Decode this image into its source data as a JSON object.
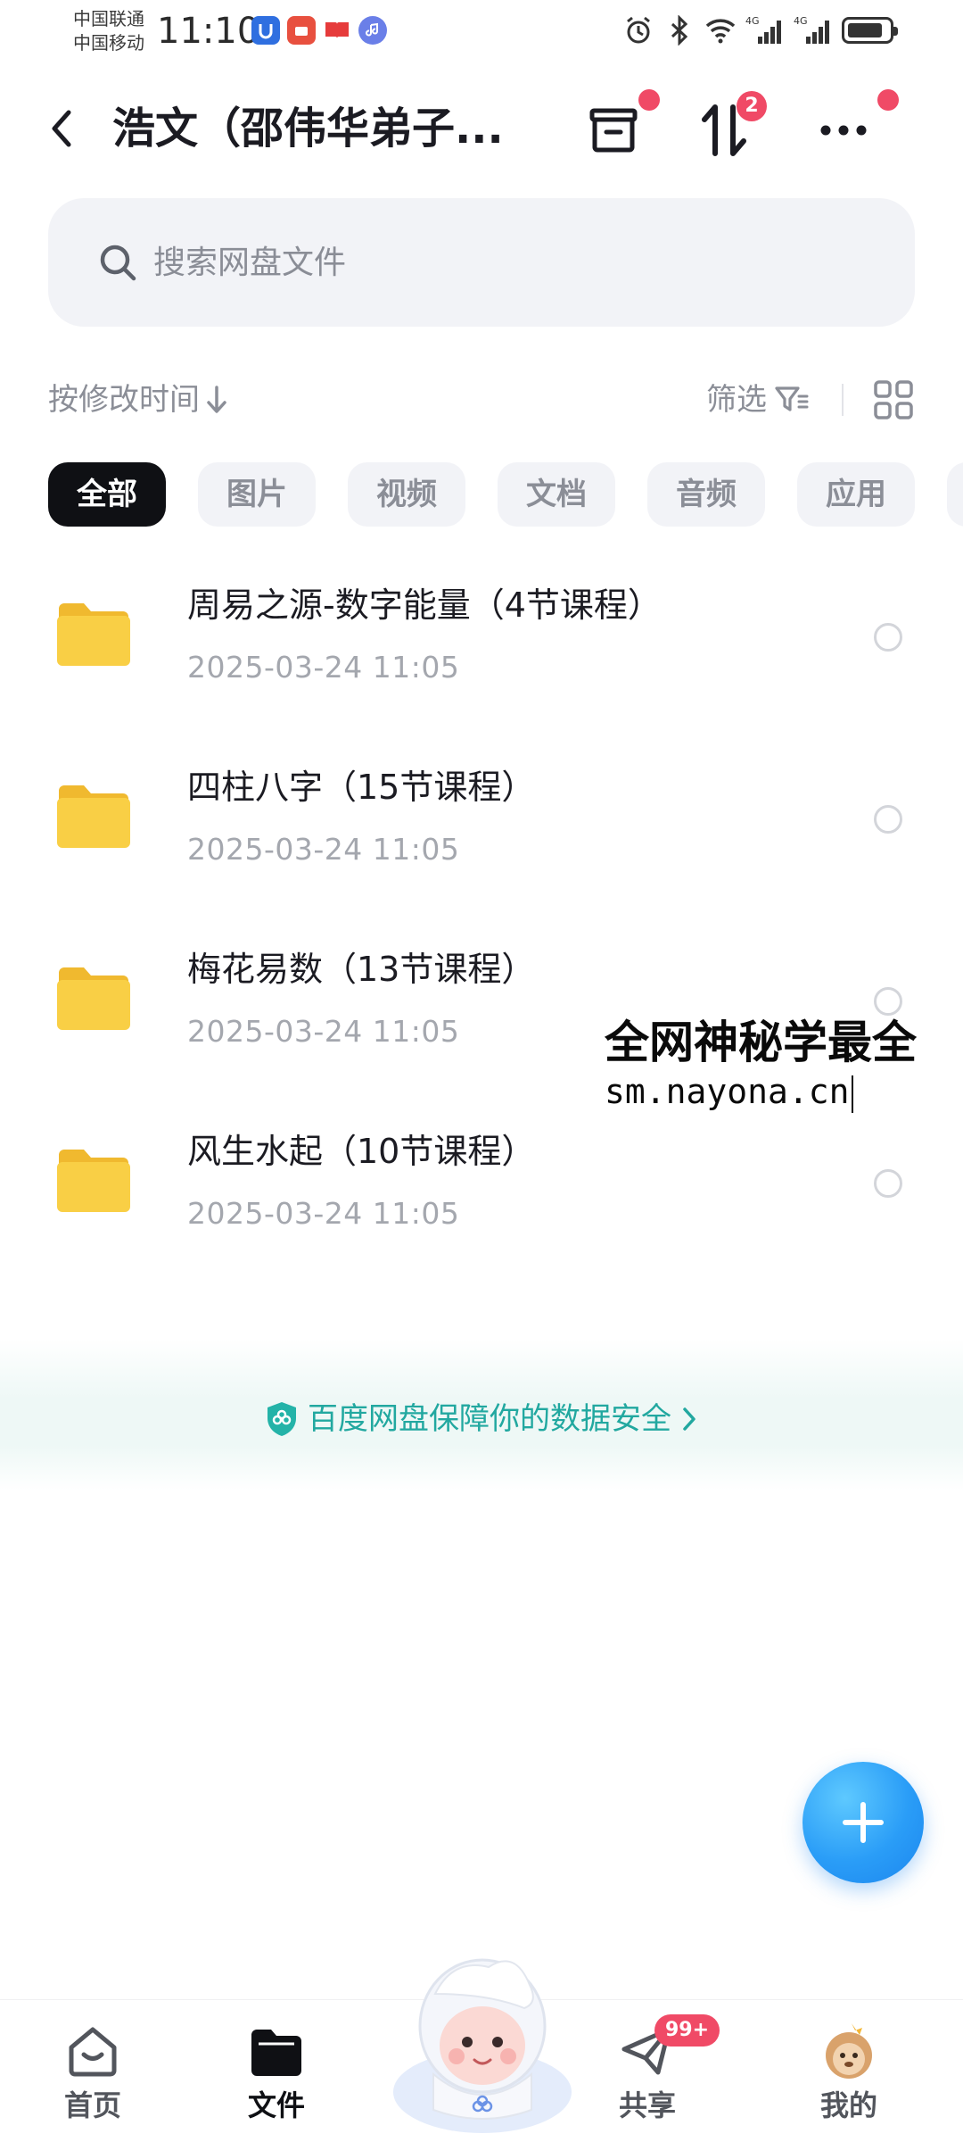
{
  "status_bar": {
    "carrier_1": "中国联通",
    "carrier_2": "中国移动",
    "time": "11:10",
    "network_1": "4G",
    "network_2": "4G"
  },
  "header": {
    "title": "浩文（邵伟华弟子...",
    "transfer_badge": "2"
  },
  "search": {
    "placeholder": "搜索网盘文件"
  },
  "toolbar": {
    "sort_label": "按修改时间",
    "filter_label": "筛选"
  },
  "categories": [
    {
      "label": "全部",
      "active": true
    },
    {
      "label": "图片",
      "active": false
    },
    {
      "label": "视频",
      "active": false
    },
    {
      "label": "文档",
      "active": false
    },
    {
      "label": "音频",
      "active": false
    },
    {
      "label": "应用",
      "active": false
    }
  ],
  "files": [
    {
      "name": "周易之源-数字能量（4节课程）",
      "date": "2025-03-24  11:05",
      "type": "folder"
    },
    {
      "name": "四柱八字（15节课程）",
      "date": "2025-03-24  11:05",
      "type": "folder"
    },
    {
      "name": "梅花易数（13节课程）",
      "date": "2025-03-24  11:05",
      "type": "folder"
    },
    {
      "name": "风生水起（10节课程）",
      "date": "2025-03-24  11:05",
      "type": "folder"
    }
  ],
  "watermark": {
    "line1": "全网神秘学最全",
    "line2": "sm.nayona.cn"
  },
  "security_notice": {
    "text": "百度网盘保障你的数据安全"
  },
  "bottom_nav": {
    "items": [
      {
        "label": "首页",
        "icon": "home-icon",
        "active": false
      },
      {
        "label": "文件",
        "icon": "folder-icon",
        "active": true
      },
      {
        "label": "",
        "icon": "mascot-icon",
        "active": false
      },
      {
        "label": "共享",
        "icon": "share-icon",
        "active": false,
        "badge": "99+"
      },
      {
        "label": "我的",
        "icon": "avatar-icon",
        "active": false
      }
    ]
  },
  "colors": {
    "accent_blue": "#2a9df7",
    "badge_red": "#f04a66",
    "security_teal": "#22a8a0",
    "folder_yellow": "#f7c843"
  }
}
